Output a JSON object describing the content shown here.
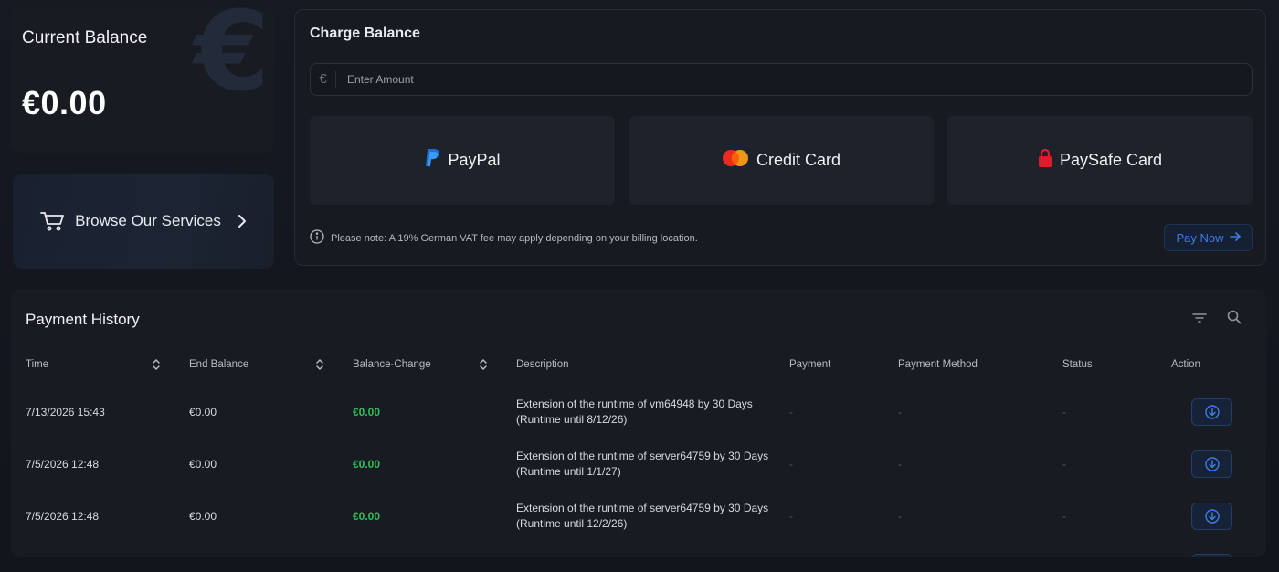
{
  "balance": {
    "title": "Current Balance",
    "value": "€0.00"
  },
  "browse": {
    "label": "Browse Our Services"
  },
  "charge": {
    "title": "Charge Balance",
    "currency_symbol": "€",
    "amount_placeholder": "Enter Amount",
    "methods": [
      {
        "label": "PayPal",
        "icon": "paypal-icon"
      },
      {
        "label": "Credit Card",
        "icon": "mastercard-icon"
      },
      {
        "label": "PaySafe Card",
        "icon": "lock-icon"
      }
    ],
    "vat_note": "Please note: A 19% German VAT fee may apply depending on your billing location.",
    "pay_now_label": "Pay Now"
  },
  "history": {
    "title": "Payment History",
    "columns": [
      "Time",
      "End Balance",
      "Balance-Change",
      "Description",
      "Payment",
      "Payment Method",
      "Status",
      "Action"
    ],
    "rows": [
      {
        "time": "7/13/2026 15:43",
        "end_balance": "€0.00",
        "change": "€0.00",
        "description": "Extension of the runtime of vm64948 by 30 Days (Runtime until 8/12/26)",
        "payment": "-",
        "method": "-",
        "status": "-"
      },
      {
        "time": "7/5/2026 12:48",
        "end_balance": "€0.00",
        "change": "€0.00",
        "description": "Extension of the runtime of server64759 by 30 Days (Runtime until 1/1/27)",
        "payment": "-",
        "method": "-",
        "status": "-"
      },
      {
        "time": "7/5/2026 12:48",
        "end_balance": "€0.00",
        "change": "€0.00",
        "description": "Extension of the runtime of server64759 by 30 Days (Runtime until 12/2/26)",
        "payment": "-",
        "method": "-",
        "status": "-"
      }
    ]
  },
  "colors": {
    "accent": "#3f7ce6",
    "positive": "#2fbf5b",
    "background": "#13161c",
    "card": "#181b22"
  }
}
